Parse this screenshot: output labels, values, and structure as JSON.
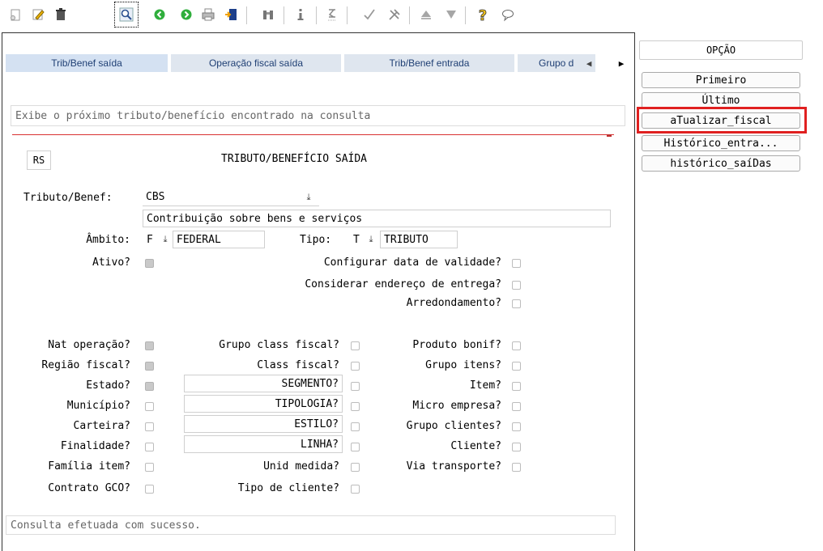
{
  "toolbar": {
    "icons": [
      "new-document-icon",
      "edit-pencil-icon",
      "trash-icon",
      "search-magnifier-icon",
      "previous-green-icon",
      "next-green-icon",
      "print-icon",
      "exit-door-icon",
      "binoculars-icon",
      "info-icon",
      "sum-icon",
      "check-icon",
      "tools-icon",
      "arrow-up-icon",
      "filter-icon",
      "help-question-icon",
      "comment-bubble-icon"
    ]
  },
  "tabs": [
    "Trib/Benef saída",
    "Operação fiscal saída",
    "Trib/Benef entrada",
    "Grupo d"
  ],
  "hint_message": "Exibe o próximo tributo/benefício encontrado na consulta",
  "form": {
    "uf_code": "RS",
    "section_title": "TRIBUTO/BENEFÍCIO SAÍDA",
    "tributo_label": "Tributo/Benef:",
    "tributo_value": "CBS",
    "tributo_desc": "Contribuição sobre bens e serviços",
    "ambito_label": "Âmbito:",
    "ambito_code": "F",
    "ambito_value": "FEDERAL",
    "tipo_label": "Tipo:",
    "tipo_code": "T",
    "tipo_value": "TRIBUTO",
    "ativo_label": "Ativo?",
    "configurar_label": "Configurar data de validade?",
    "considerar_label": "Considerar endereço de entrega?",
    "arredondamento_label": "Arredondamento?"
  },
  "criteria": {
    "col1": [
      {
        "label": "Nat operação?",
        "checked": true
      },
      {
        "label": "Região fiscal?",
        "checked": true
      },
      {
        "label": "Estado?",
        "checked": true
      },
      {
        "label": "Município?",
        "checked": false
      },
      {
        "label": "Carteira?",
        "checked": false
      },
      {
        "label": "Finalidade?",
        "checked": false
      },
      {
        "label": "Família item?",
        "checked": false
      },
      {
        "label": "Contrato GCO?",
        "checked": false
      }
    ],
    "col2": [
      {
        "label": "Grupo class fiscal?",
        "checked": false
      },
      {
        "label": "Class fiscal?",
        "checked": false
      },
      {
        "label": "SEGMENTO?",
        "checked": false
      },
      {
        "label": "TIPOLOGIA?",
        "checked": false
      },
      {
        "label": "ESTILO?",
        "checked": false
      },
      {
        "label": "LINHA?",
        "checked": false
      },
      {
        "label": "Unid medida?",
        "checked": false
      },
      {
        "label": "Tipo de cliente?",
        "checked": false
      }
    ],
    "col3": [
      {
        "label": "Produto bonif?",
        "checked": false
      },
      {
        "label": "Grupo itens?",
        "checked": false
      },
      {
        "label": "Item?",
        "checked": false
      },
      {
        "label": "Micro empresa?",
        "checked": false
      },
      {
        "label": "Grupo clientes?",
        "checked": false
      },
      {
        "label": "Cliente?",
        "checked": false
      },
      {
        "label": "Via transporte?",
        "checked": false
      }
    ]
  },
  "status_message": "Consulta efetuada com sucesso.",
  "side_panel": {
    "title": "OPÇÃO",
    "buttons": [
      "Primeiro",
      "Último",
      "aTualizar_fiscal",
      "Histórico_entra...",
      "histórico_saíDas"
    ]
  },
  "colors": {
    "highlight": "#e02020",
    "tab_text": "#1f3f74",
    "tab_bg": "#dfe6ef"
  }
}
